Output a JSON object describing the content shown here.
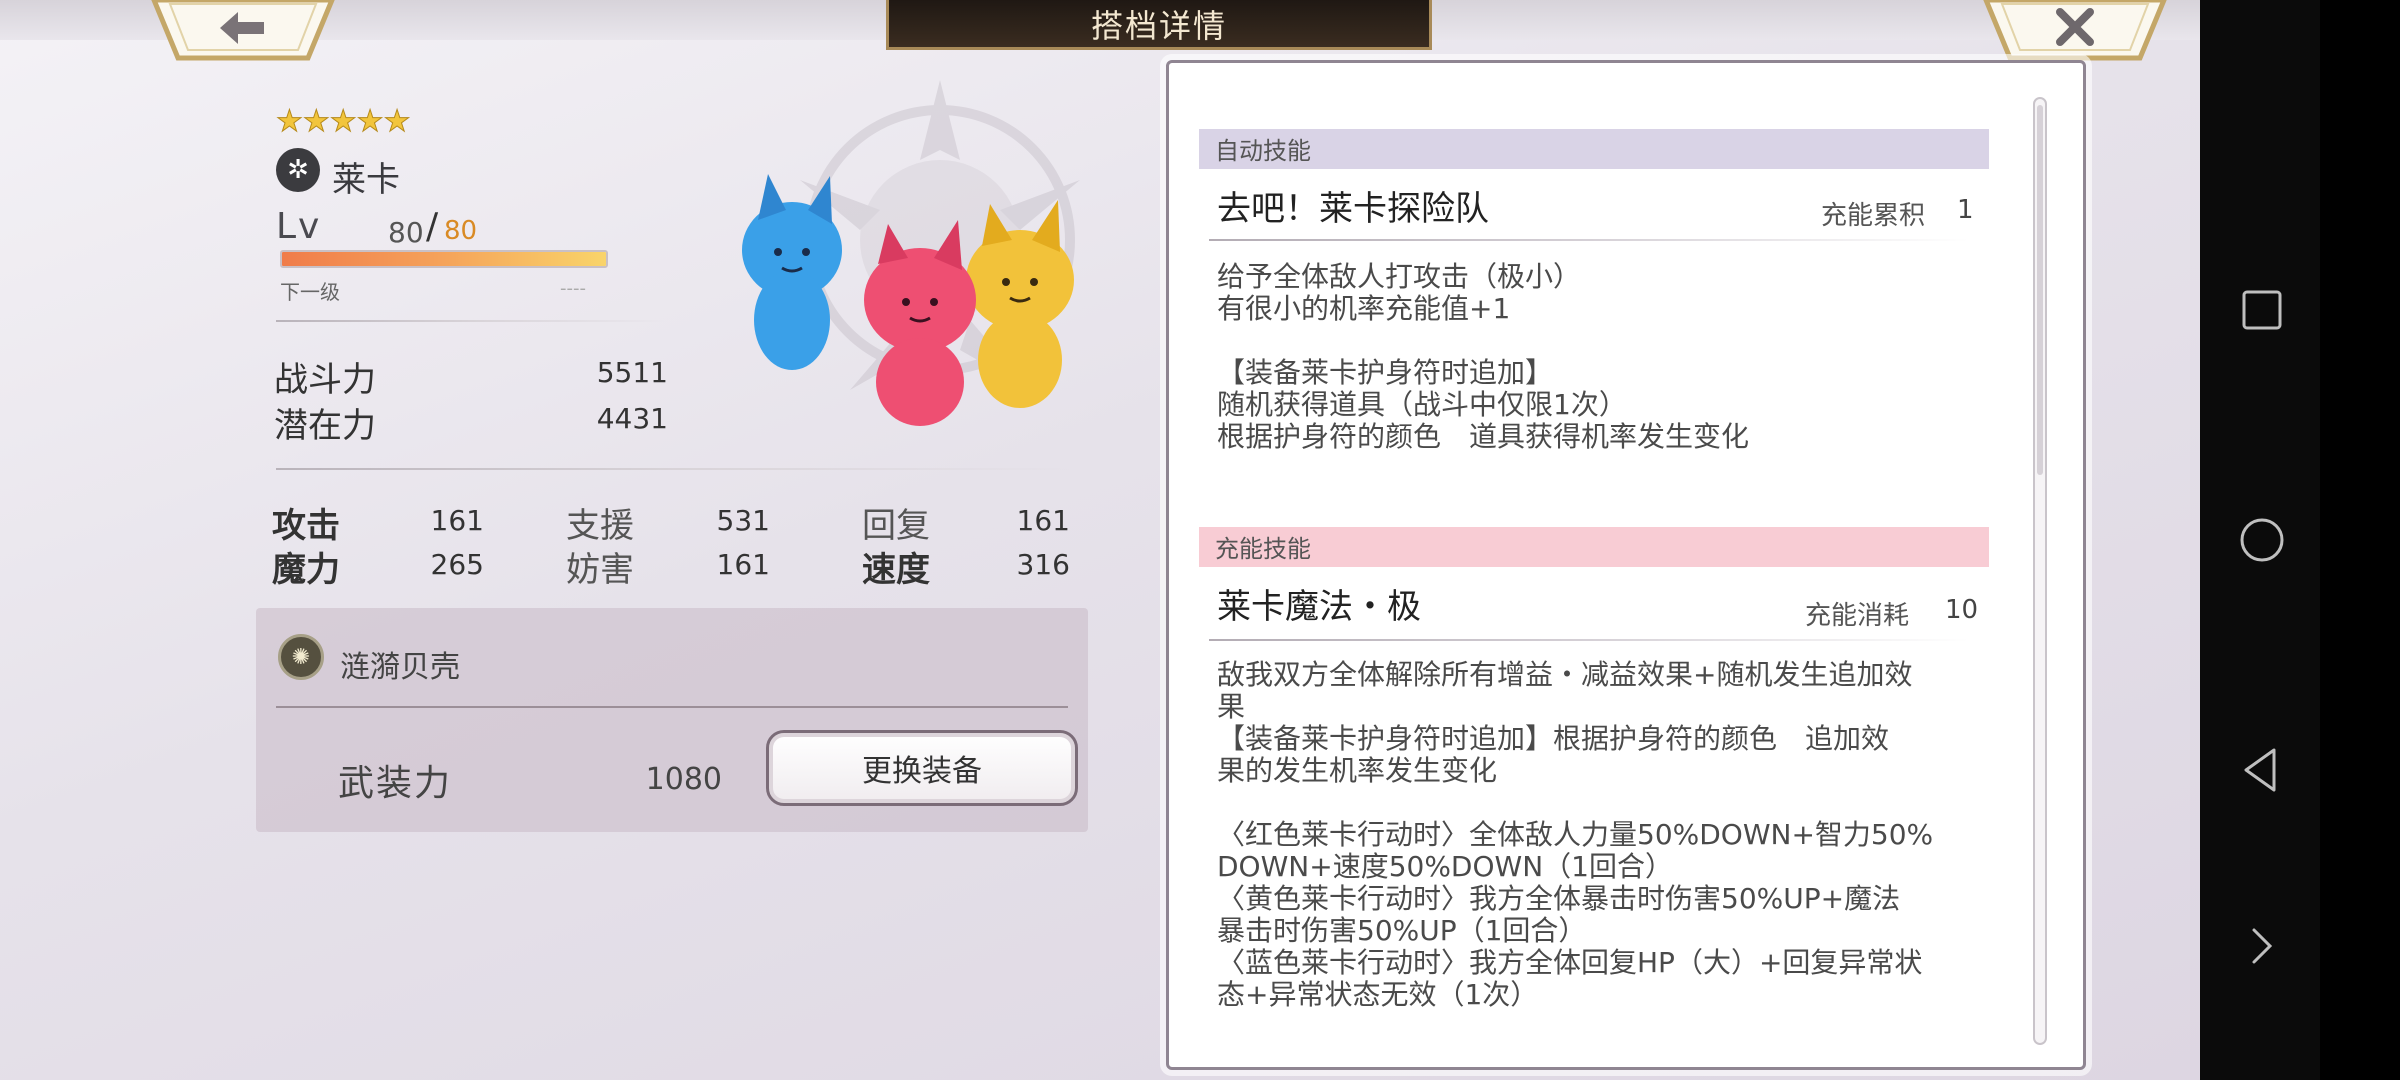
{
  "header": {
    "title": "搭档详情",
    "back_icon": "arrow-left-icon",
    "close_icon": "close-x-icon"
  },
  "partner": {
    "stars": "★★★★★",
    "name": "莱卡",
    "lv_label": "Lv",
    "lv_current": "80",
    "lv_slash": "/",
    "lv_max": "80",
    "exp_fraction": 1.0,
    "next_label": "下一级",
    "next_value": "----"
  },
  "stats": {
    "combat_label": "战斗力",
    "combat_value": "5511",
    "potential_label": "潜在力",
    "potential_value": "4431"
  },
  "attributes": [
    {
      "label": "攻击",
      "value": "161"
    },
    {
      "label": "支援",
      "value": "531"
    },
    {
      "label": "回复",
      "value": "161"
    },
    {
      "label": "魔力",
      "value": "265"
    },
    {
      "label": "妨害",
      "value": "161"
    },
    {
      "label": "速度",
      "value": "316"
    }
  ],
  "equipment": {
    "name": "涟漪贝壳",
    "armed_label": "武装力",
    "armed_value": "1080",
    "change_button": "更换装备"
  },
  "auto_skill": {
    "section_label": "自动技能",
    "name": "去吧！莱卡探险队",
    "meta_label": "充能累积",
    "meta_value": "1",
    "lines": [
      "给予全体敌人打攻击（极小）",
      "有很小的机率充能值+1",
      "",
      "【装备莱卡护身符时追加】",
      "随机获得道具（战斗中仅限1次）",
      "根据护身符的颜色　道具获得机率发生变化"
    ]
  },
  "charge_skill": {
    "section_label": "充能技能",
    "name": "莱卡魔法・极",
    "meta_label": "充能消耗",
    "meta_value": "10",
    "lines": [
      "敌我双方全体解除所有增益・减益效果+随机发生追加效",
      "果",
      "【装备莱卡护身符时追加】根据护身符的颜色　追加效",
      "果的发生机率发生变化",
      "",
      "〈红色莱卡行动时〉全体敌人力量50%DOWN+智力50%",
      "DOWN+速度50%DOWN（1回合）",
      "〈黄色莱卡行动时〉我方全体暴击时伤害50%UP+魔法",
      "暴击时伤害50%UP（1回合）",
      "〈蓝色莱卡行动时〉我方全体回复HP（大）+回复异常状",
      "态+异常状态无效（1次）"
    ]
  },
  "colors": {
    "auto_bar": "#d9d3e6",
    "charge_bar": "#f8ccd4",
    "lv_max": "#d98a24",
    "stars": "#f2c53c"
  },
  "navbar": {
    "square_icon": "recent-apps-icon",
    "circle_icon": "home-icon",
    "triangle_icon": "back-icon",
    "chevron_icon": "chevron-right-icon"
  }
}
